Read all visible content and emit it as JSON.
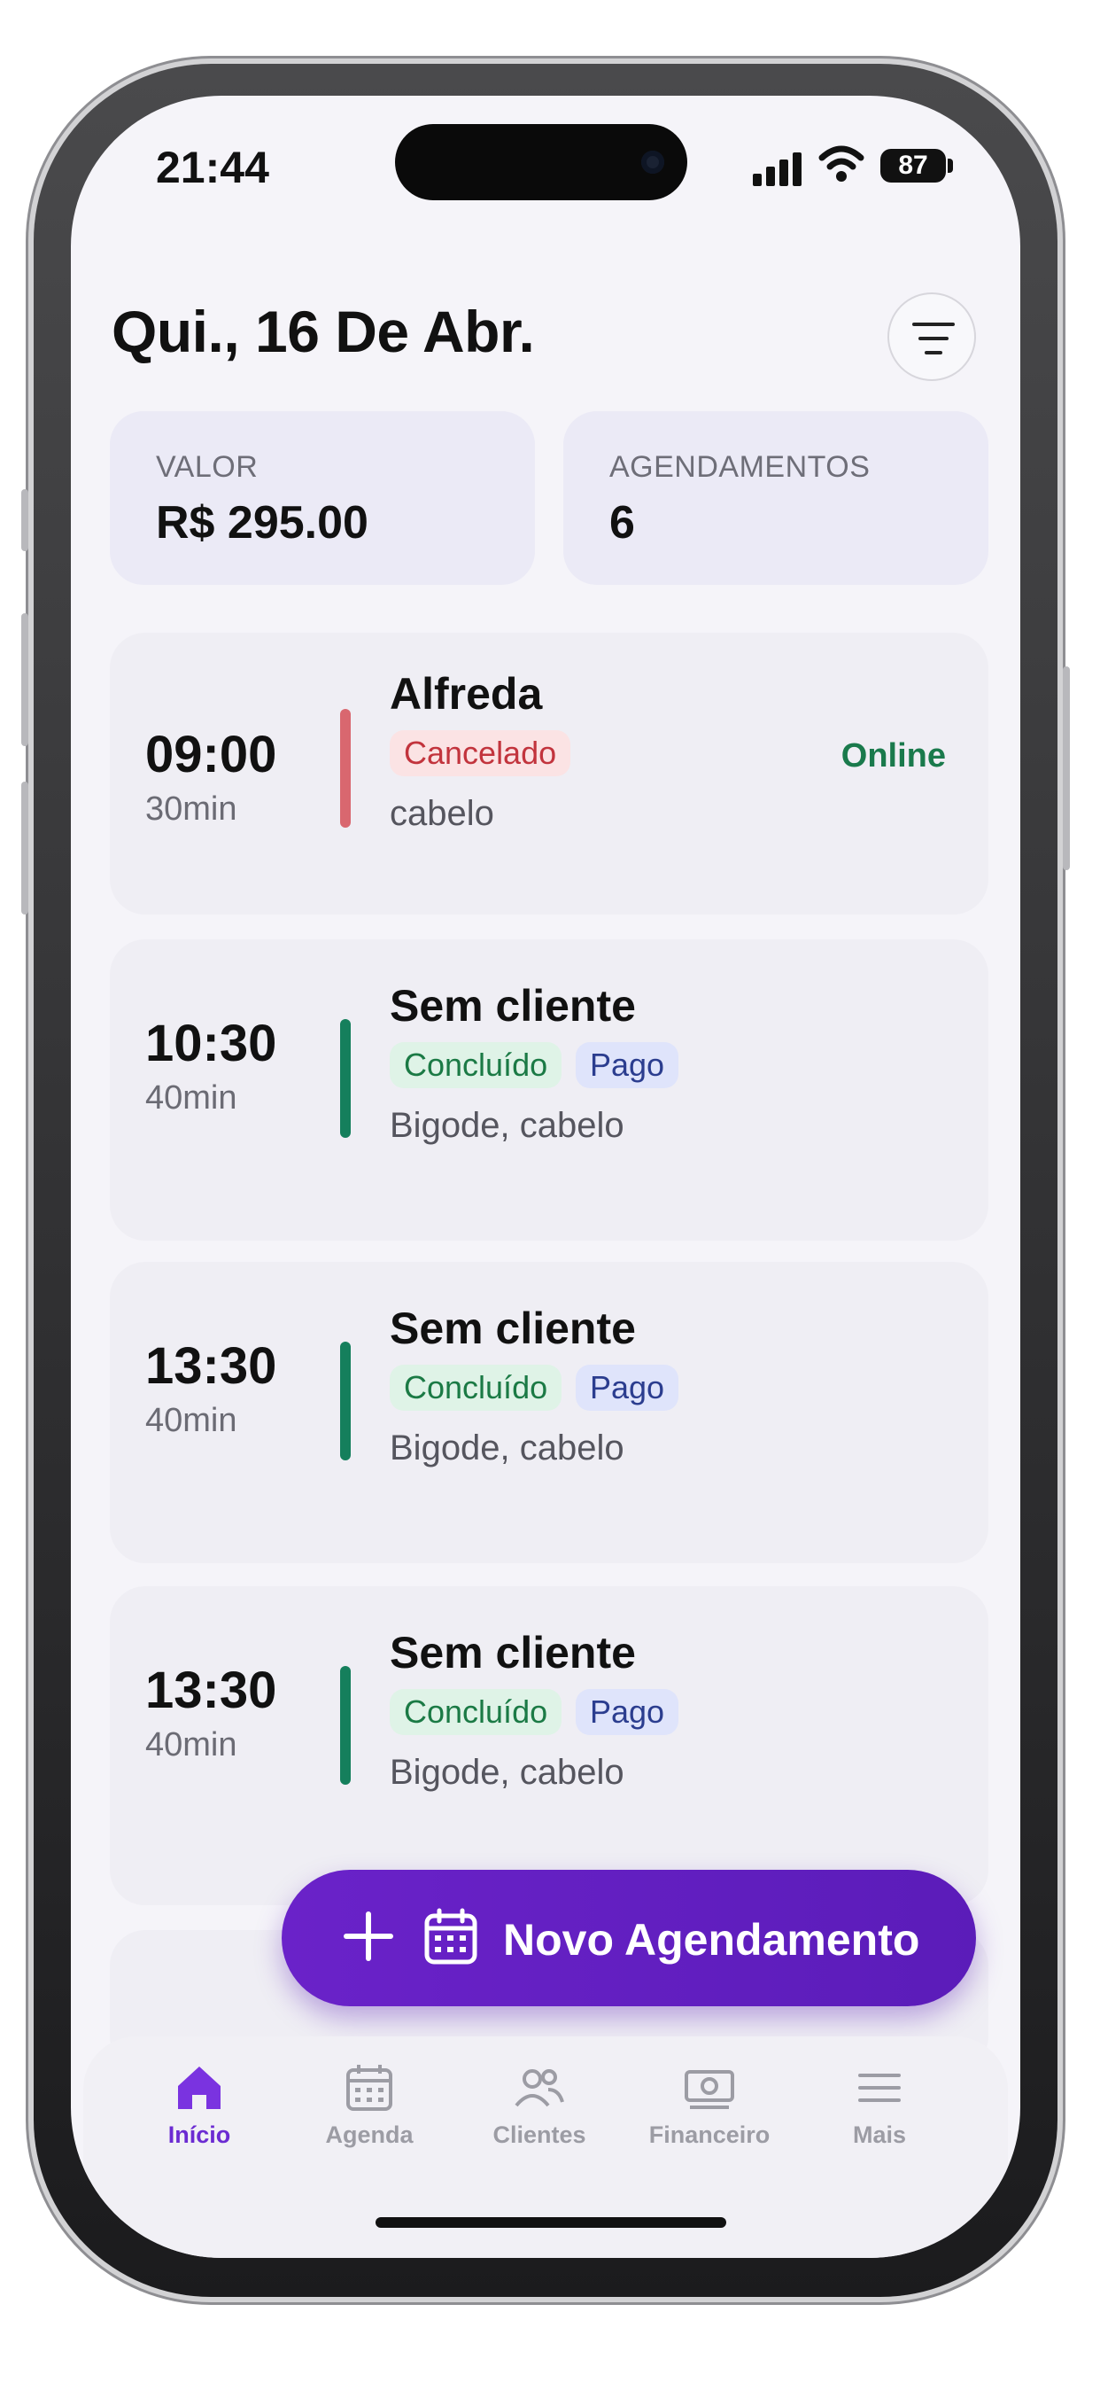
{
  "status_bar": {
    "time": "21:44",
    "battery": "87"
  },
  "header": {
    "date": "Qui., 16 De Abr."
  },
  "stats": [
    {
      "label": "VALOR",
      "value": "R$ 295.00"
    },
    {
      "label": "AGENDAMENTOS",
      "value": "6"
    }
  ],
  "appointments": [
    {
      "time": "09:00",
      "duration": "30min",
      "client": "Alfreda",
      "status": "Cancelado",
      "payment": "",
      "services": "cabelo",
      "channel": "Online"
    },
    {
      "time": "10:30",
      "duration": "40min",
      "client": "Sem cliente",
      "status": "Concluído",
      "payment": "Pago",
      "services": "Bigode, cabelo",
      "channel": ""
    },
    {
      "time": "13:30",
      "duration": "40min",
      "client": "Sem cliente",
      "status": "Concluído",
      "payment": "Pago",
      "services": "Bigode, cabelo",
      "channel": ""
    },
    {
      "time": "13:30",
      "duration": "40min",
      "client": "Sem cliente",
      "status": "Concluído",
      "payment": "Pago",
      "services": "Bigode, cabelo",
      "channel": ""
    }
  ],
  "fab": {
    "label": "Novo Agendamento"
  },
  "tabs": [
    {
      "label": "Início",
      "icon": "home-icon",
      "active": true
    },
    {
      "label": "Agenda",
      "icon": "calendar-icon",
      "active": false
    },
    {
      "label": "Clientes",
      "icon": "users-icon",
      "active": false
    },
    {
      "label": "Financeiro",
      "icon": "money-icon",
      "active": false
    },
    {
      "label": "Mais",
      "icon": "menu-icon",
      "active": false
    }
  ],
  "colors": {
    "accent": "#6b2bd2",
    "cancel_bar": "#d9676f",
    "done_bar": "#157f5c",
    "online": "#1a7a4c"
  }
}
